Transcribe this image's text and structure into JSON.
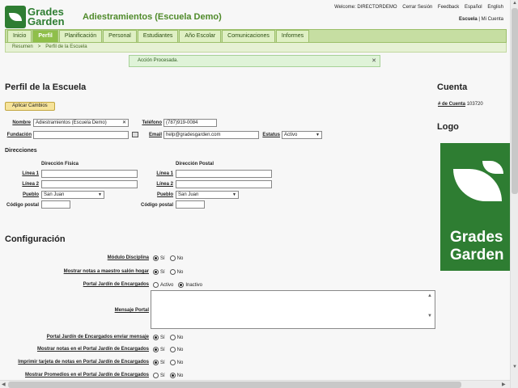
{
  "logo": {
    "line1": "Grades",
    "line2": "Garden"
  },
  "school_name": "Adiestramientos (Escuela Demo)",
  "top_links": [
    "Welcome: DIRECTORDEMO",
    "Cerrar Sesión",
    "Feedback",
    "Español",
    "English"
  ],
  "sub_links": {
    "school": "Escuela",
    "sep": " | ",
    "account": "Mi Cuenta"
  },
  "nav": [
    "Inicio",
    "Perfil",
    "Planificación",
    "Personal",
    "Estudiantes",
    "Año Escolar",
    "Comunicaciones",
    "Informes"
  ],
  "breadcrumb": [
    "Resumen",
    ">",
    "Perfil de la Escuela"
  ],
  "message": "Acción Procesada.",
  "profile": {
    "title": "Perfil de la Escuela",
    "apply_button": "Aplicar Cambios",
    "name_label": "Nombre",
    "name_value": "Adiestramientos (Escuela Demo)",
    "phone_label": "Teléfono",
    "phone_value": "(787)919-0084",
    "founded_label": "Fundación",
    "founded_value": "",
    "email_label": "Email",
    "email_value": "help@gradesgarden.com",
    "status_label": "Estatus",
    "status_value": "Activo"
  },
  "addresses": {
    "title": "Direcciones",
    "physical_header": "Dirección Física",
    "postal_header": "Dirección Postal",
    "line1": "Línea 1",
    "line2": "Línea 2",
    "town": "Pueblo",
    "zip": "Código postal",
    "physical_town": "San Juan",
    "postal_town": "San Juan"
  },
  "config": {
    "title": "Configuración",
    "rows": [
      {
        "label": "Módulo Disciplina",
        "opt1": "Sí",
        "opt2": "No",
        "selected": 1
      },
      {
        "label": "Mostrar notas a maestro salón hogar",
        "opt1": "Sí",
        "opt2": "No",
        "selected": 1
      },
      {
        "label": "Portal Jardín de Encargados",
        "opt1": "Activo",
        "opt2": "Inactivo",
        "selected": 2
      },
      {
        "label": "Portal Jardín de Encargados enviar mensaje",
        "opt1": "Sí",
        "opt2": "No",
        "selected": 1
      },
      {
        "label": "Mostrar notas en el Portal Jardín de Encargados",
        "opt1": "Sí",
        "opt2": "No",
        "selected": 1
      },
      {
        "label": "Imprimir tarjeta de notas en Portal Jardín de Encargados",
        "opt1": "Sí",
        "opt2": "No",
        "selected": 1
      },
      {
        "label": "Mostrar Promedios en el Portal Jardín de Encargados",
        "opt1": "Sí",
        "opt2": "No",
        "selected": 2
      }
    ],
    "message_label": "Mensaje Portal"
  },
  "account": {
    "title": "Cuenta",
    "number_label": "# de Cuenta",
    "number_value": "103720"
  },
  "logo_section": {
    "title": "Logo",
    "line1": "Grades",
    "line2": "Garden"
  }
}
